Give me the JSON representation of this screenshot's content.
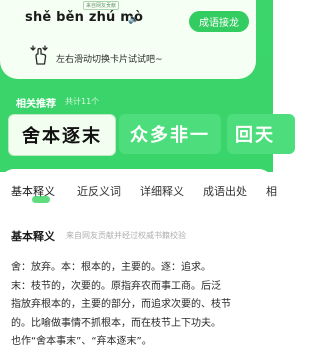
{
  "header": {
    "pinyin": "shě běn zhú mò",
    "speaker_icon": "speaker-icon",
    "badge_text": "来自网友贡献",
    "chain_button": "成语接龙",
    "hand_icon": "swipe-hand-icon",
    "swipe_hint": "左右滑动切换卡片试试吧~"
  },
  "recommend": {
    "title": "相关推荐",
    "count": "共计11个",
    "items": [
      "舍本逐末",
      "众多非一",
      "回天"
    ]
  },
  "tabs": [
    "基本释义",
    "近反义词",
    "详细释义",
    "成语出处",
    "相"
  ],
  "section": {
    "title": "基本释义",
    "note": "来自网友贡献并经过权威书籍校验",
    "lines": [
      "舍：放弃。本：根本的，主要的。逐：追求。",
      "末：枝节的，次要的。原指弃农而事工商。后泛",
      "指放弃根本的，主要的部分，而追求次要的、枝节",
      "的。比喻做事情不抓根本，而在枝节上下功夫。",
      "也作“舍本事末”、“弃本逐末”。"
    ]
  },
  "colors": {
    "brand_green": "#3bd56b",
    "card_green": "#4edd7c",
    "button_green": "#33cc60"
  }
}
